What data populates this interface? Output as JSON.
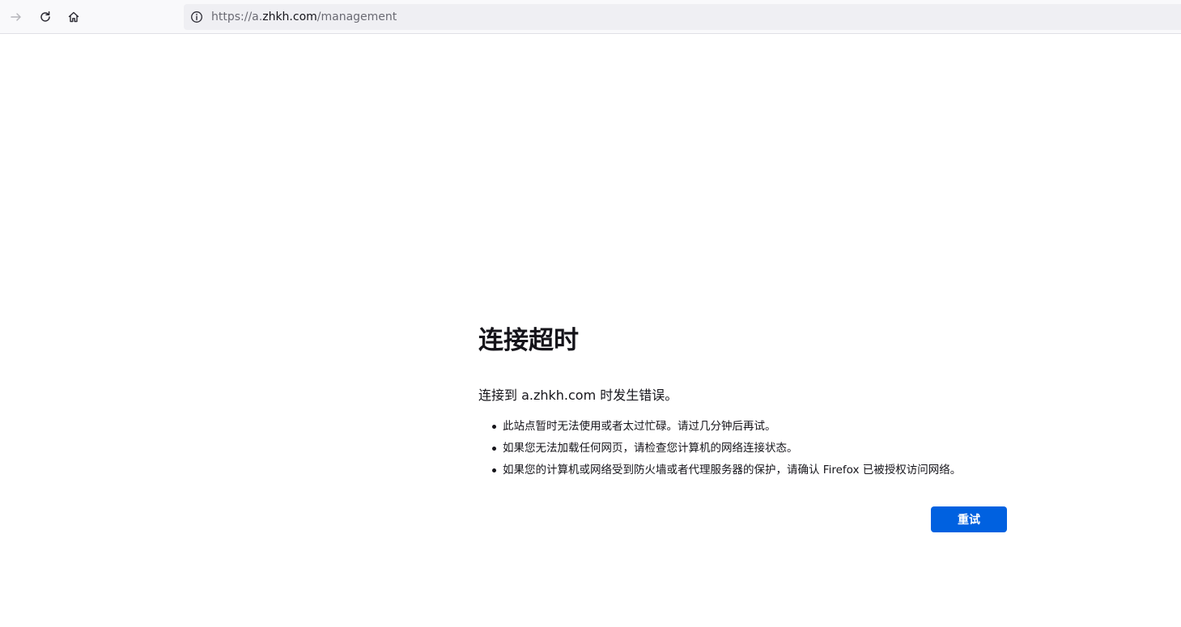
{
  "browser": {
    "forward_icon": "arrow-right-icon",
    "reload_icon": "reload-icon",
    "home_icon": "home-icon",
    "url_info_icon": "info-circle-icon",
    "url": {
      "prefix": "https://a.",
      "host": "zhkh.com",
      "path": "/management"
    }
  },
  "error": {
    "title": "连接超时",
    "description": "连接到 a.zhkh.com 时发生错误。",
    "items": [
      "此站点暂时无法使用或者太过忙碌。请过几分钟后再试。",
      "如果您无法加载任何网页，请检查您计算机的网络连接状态。",
      "如果您的计算机或网络受到防火墙或者代理服务器的保护，请确认 Firefox 已被授权访问网络。"
    ],
    "retry_label": "重试"
  },
  "colors": {
    "accent": "#0061e0",
    "text": "#15141a",
    "url_muted": "#6a6a73",
    "toolbar_bg": "#f9f9fb",
    "urlbar_bg": "#efeff3"
  }
}
